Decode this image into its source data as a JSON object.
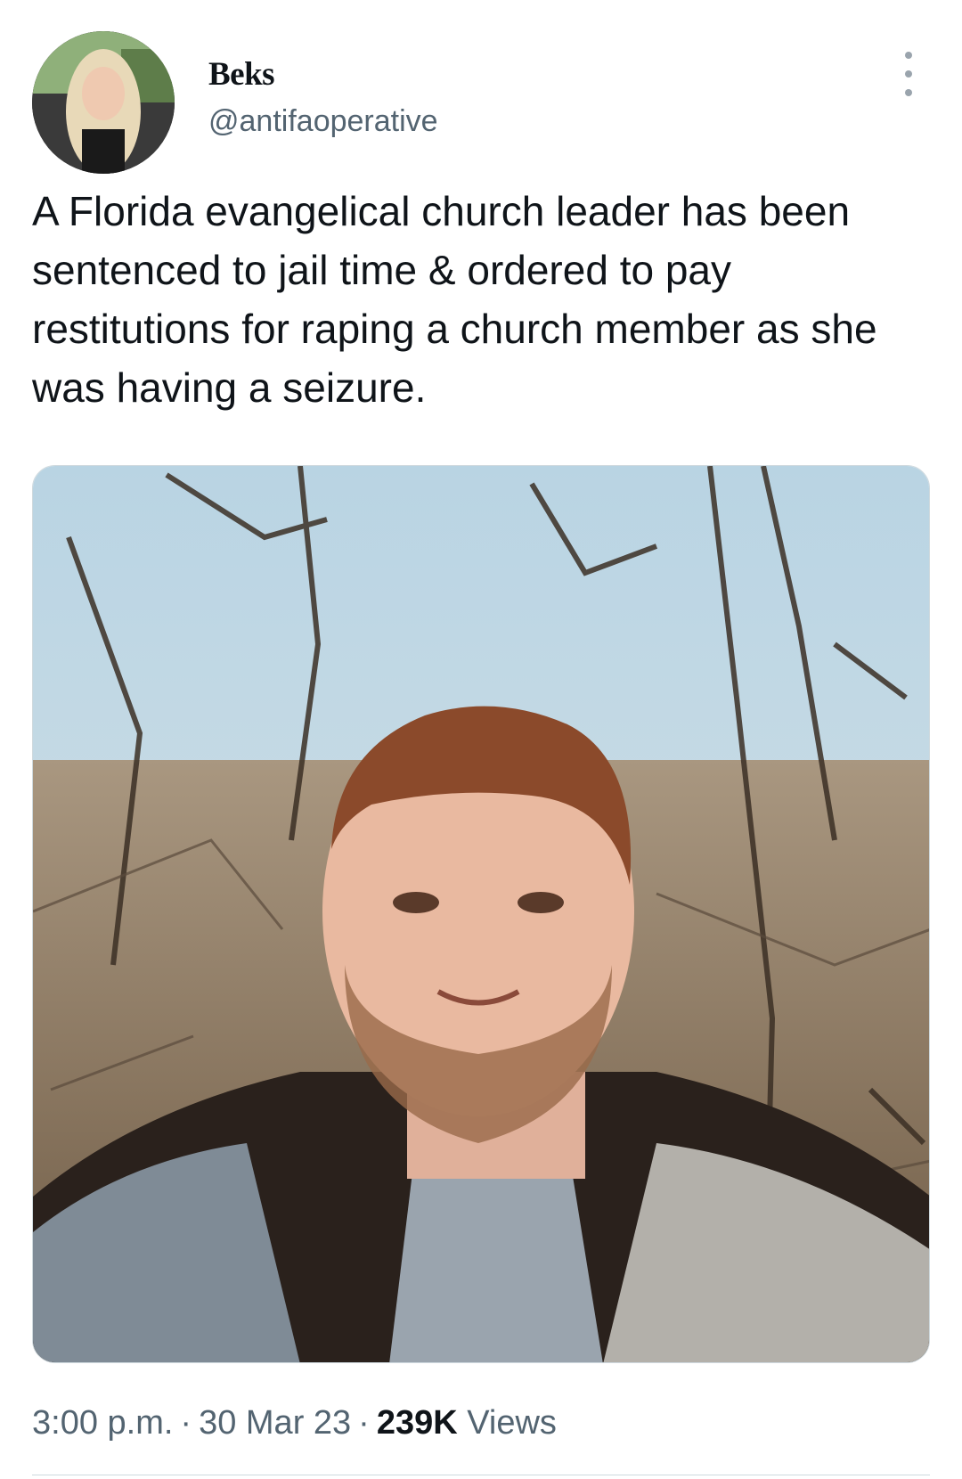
{
  "tweet": {
    "author": {
      "display_name": "Beks",
      "handle": "@antifaoperative"
    },
    "text": "A Florida evangelical church leader has been sentenced to jail time & ordered to pay restitutions for raping a church member as she was having a seizure.",
    "meta": {
      "time": "3:00 p.m.",
      "separator": "·",
      "date": "30 Mar 23",
      "views_count": "239K",
      "views_label": "Views"
    },
    "icons": {
      "more": "more-options-icon"
    }
  },
  "colors": {
    "text_primary": "#0f1419",
    "text_secondary": "#536471",
    "border": "#cfd9de",
    "background": "#ffffff"
  }
}
